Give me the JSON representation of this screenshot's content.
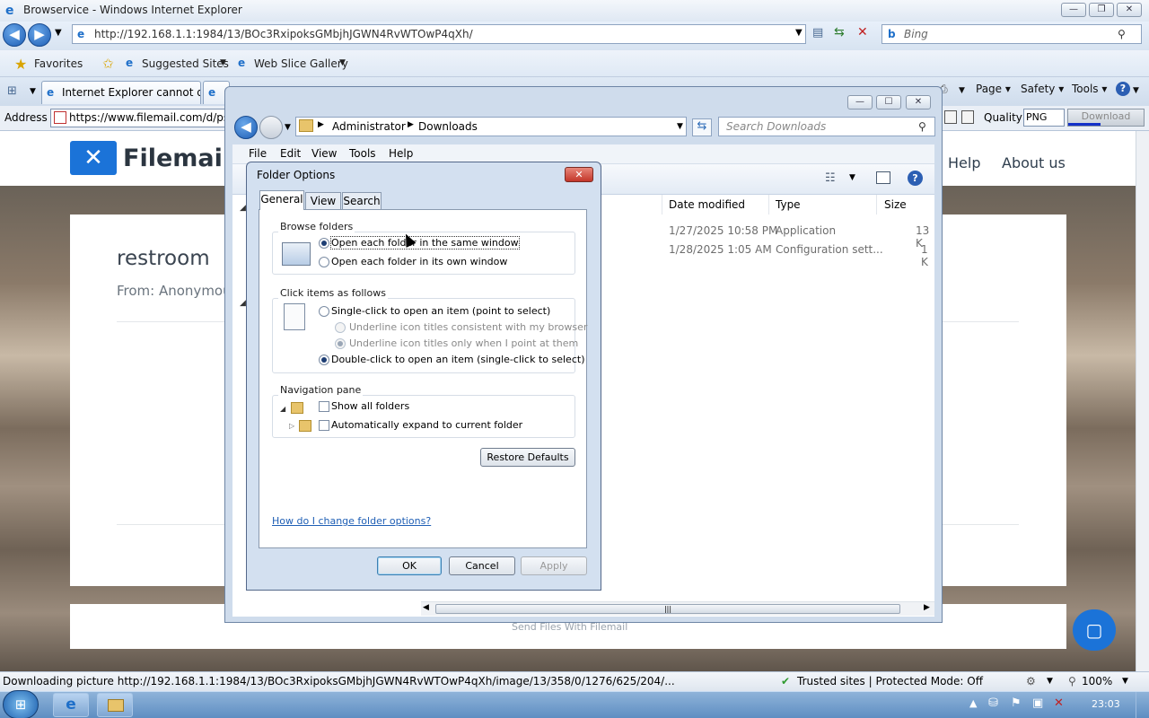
{
  "ie": {
    "window_title": "Browservice - Windows Internet Explorer",
    "url": "http://192.168.1.1:1984/13/BOc3RxipoksGMbjhJGWN4RvWTOwP4qXh/",
    "search_placeholder": "Bing",
    "favorites_label": "Favorites",
    "suggested_sites": "Suggested Sites",
    "web_slice_gallery": "Web Slice Gallery",
    "tab1": "Internet Explorer cannot di...",
    "cmd_page": "Page",
    "cmd_safety": "Safety",
    "cmd_tools": "Tools",
    "address_label": "Address",
    "address_value": "https://www.filemail.com/d/psic",
    "quality_label": "Quality",
    "quality_value": "PNG",
    "download_label": "Download",
    "status_text": "Downloading picture http://192.168.1.1:1984/13/BOc3RxipoksGMbjhJGWN4RvWTOwP4qXh/image/13/358/0/1276/625/204/...",
    "zone_text": "Trusted sites | Protected Mode: Off",
    "zoom": "100%"
  },
  "site": {
    "logo": "Filemail",
    "nav_help": "Help",
    "nav_about": "About us",
    "title": "restroom",
    "from": "From: Anonymou",
    "footer": "Send Files With Filemail"
  },
  "explorer": {
    "crumb1": "Administrator",
    "crumb2": "Downloads",
    "search_placeholder": "Search Downloads",
    "menu": [
      "File",
      "Edit",
      "View",
      "Tools",
      "Help"
    ],
    "columns": {
      "date": "Date modified",
      "type": "Type",
      "size": "Size"
    },
    "rows": [
      {
        "date": "1/27/2025 10:58 PM",
        "type": "Application",
        "size": "13 K"
      },
      {
        "date": "1/28/2025 1:05 AM",
        "type": "Configuration sett...",
        "size": "1 K"
      }
    ]
  },
  "dialog": {
    "title": "Folder Options",
    "tabs": [
      "General",
      "View",
      "Search"
    ],
    "browse_group": "Browse folders",
    "browse_same": "Open each folder in the same window",
    "browse_own": "Open each folder in its own window",
    "click_group": "Click items as follows",
    "single_click": "Single-click to open an item (point to select)",
    "underline_browser": "Underline icon titles consistent with my browser",
    "underline_point": "Underline icon titles only when I point at them",
    "double_click": "Double-click to open an item (single-click to select)",
    "nav_group": "Navigation pane",
    "show_all": "Show all folders",
    "auto_expand": "Automatically expand to current folder",
    "restore": "Restore Defaults",
    "help_link": "How do I change folder options?",
    "ok": "OK",
    "cancel": "Cancel",
    "apply": "Apply"
  },
  "taskbar": {
    "clock": "23:03"
  }
}
